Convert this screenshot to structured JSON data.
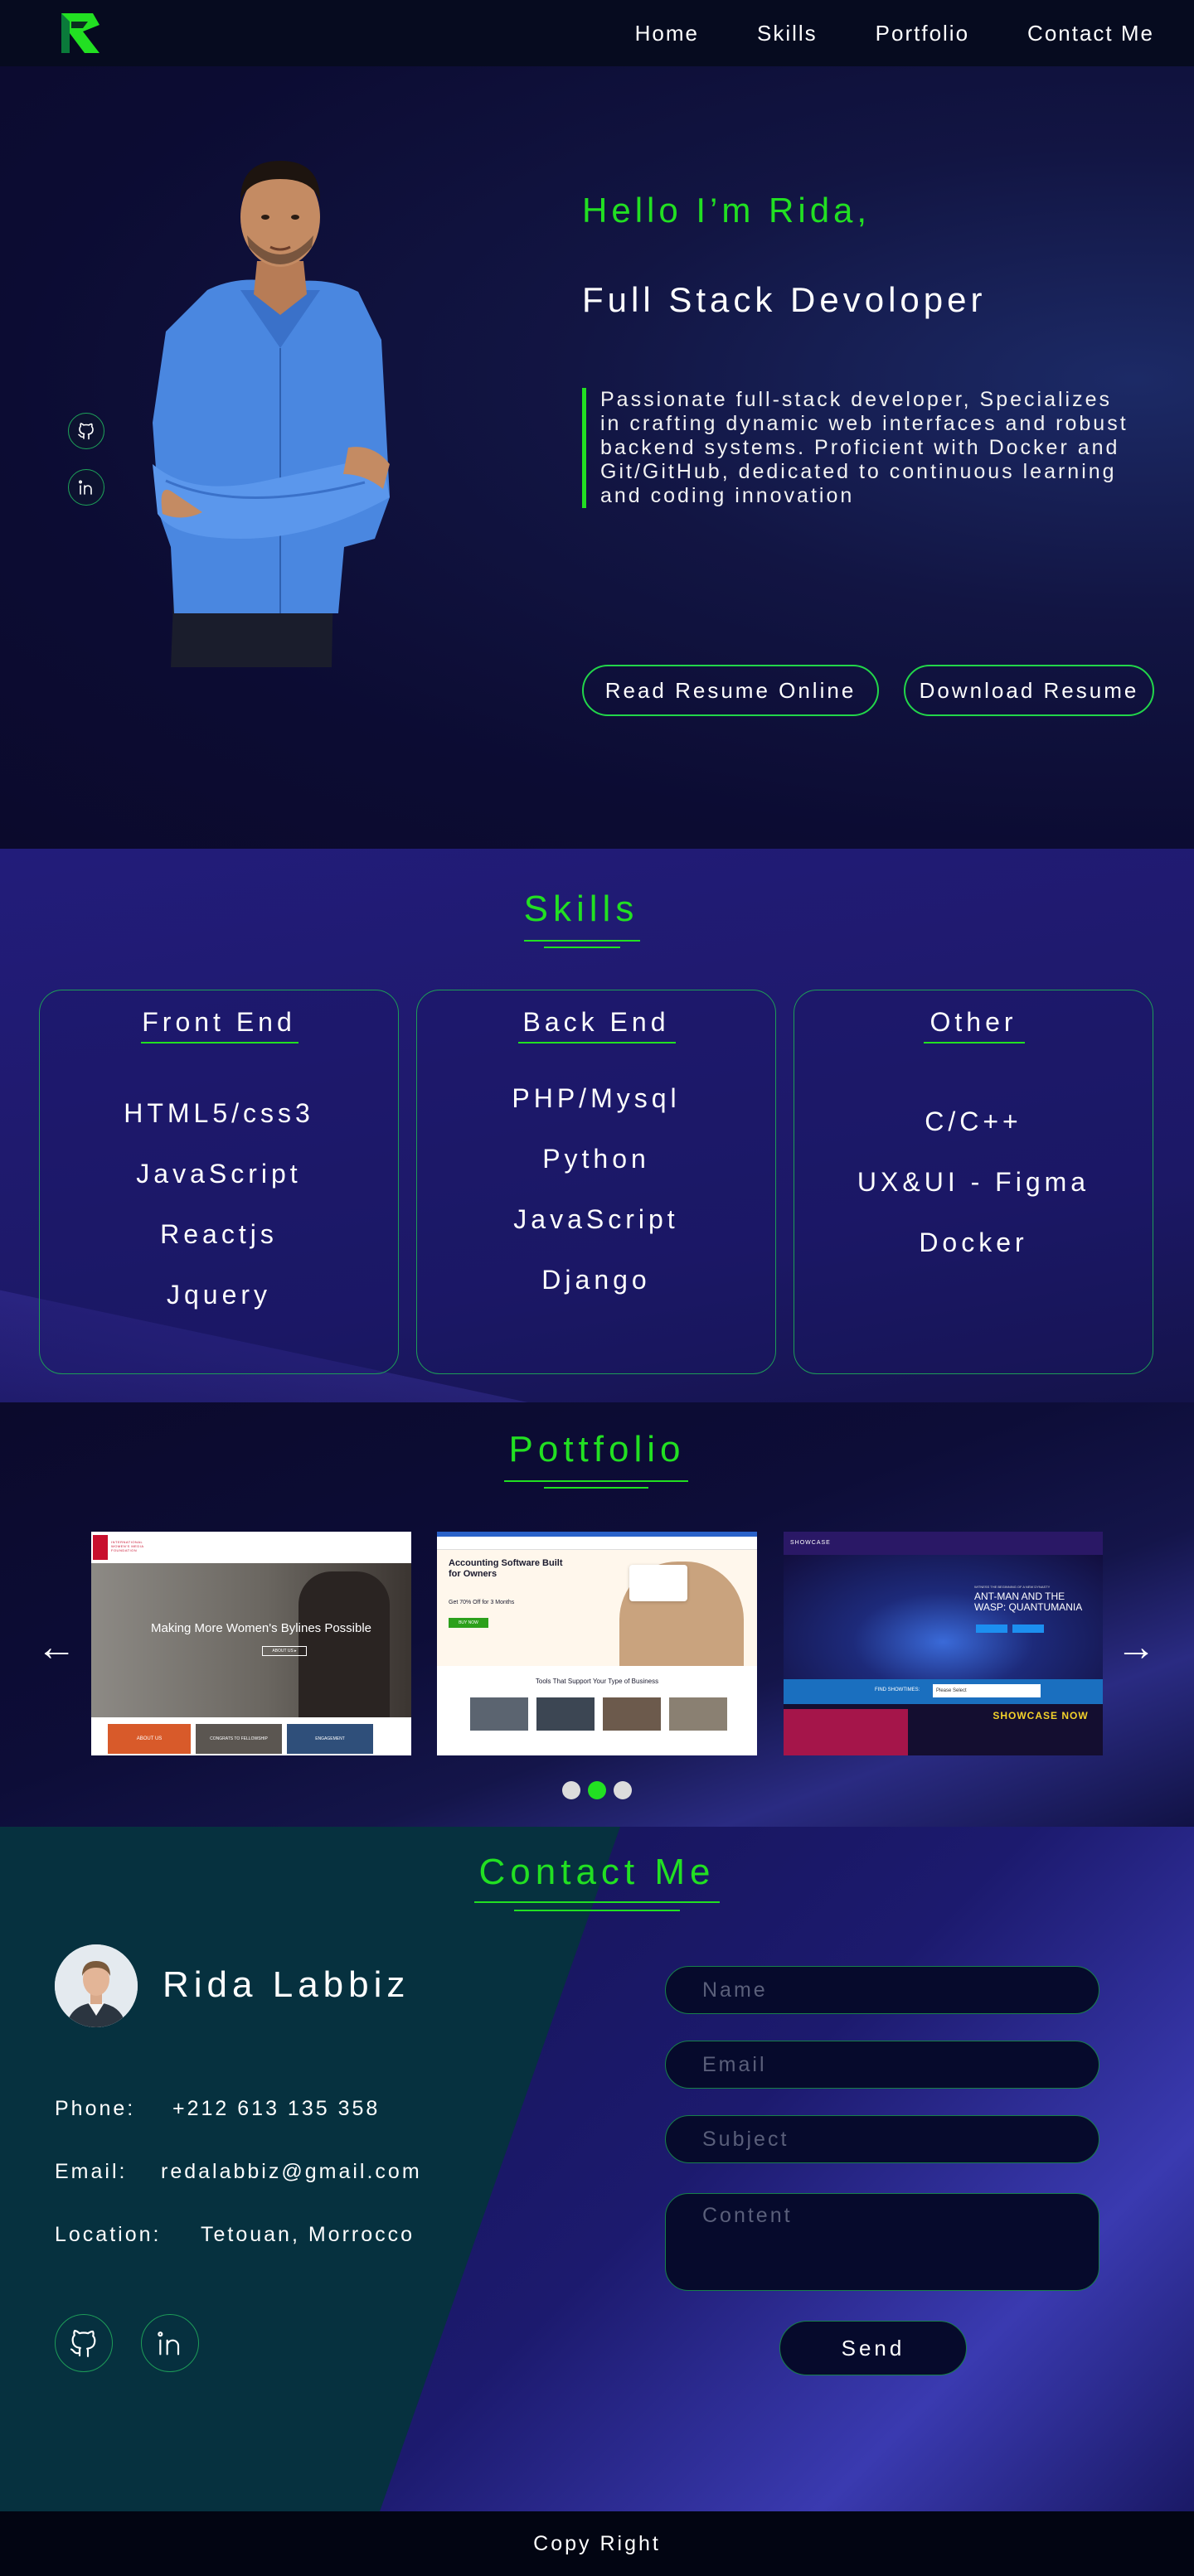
{
  "nav": {
    "logo_icon": "brand-logo",
    "links": [
      "Home",
      "Skills",
      "Portfolio",
      "Contact Me"
    ]
  },
  "hero": {
    "greeting": "Hello I’m Rida,",
    "role": "Full Stack Devoloper",
    "description": "Passionate full-stack developer, Specializes in crafting dynamic web interfaces and robust backend systems. Proficient with Docker and Git/GitHub, dedicated to continuous learning and coding innovation",
    "buttons": [
      "Read Resume Online",
      "Download Resume"
    ],
    "side_icons": [
      "github-icon",
      "linkedin-icon"
    ]
  },
  "skills": {
    "title": "Skills",
    "cards": [
      {
        "title": "Front End",
        "items": [
          "HTML5/css3",
          "JavaScript",
          "Reactjs",
          "Jquery"
        ]
      },
      {
        "title": "Back End",
        "items": [
          "PHP/Mysql",
          "Python",
          "JavaScript",
          "Django"
        ]
      },
      {
        "title": "Other",
        "items": [
          "C/C++",
          "UX&UI - Figma",
          "Docker"
        ]
      }
    ]
  },
  "portfolio": {
    "title": "Pottfolio",
    "prev": "←",
    "next": "→",
    "slides": [
      {
        "headline": "Making More Women's Bylines Possible",
        "tag": "ABOUT US ▸",
        "nav_brand": "INTERNATIONAL WOMEN'S MEDIA FOUNDATION",
        "tiles": [
          "ABOUT US",
          "CONGRATS TO FELLOWSHIP",
          "ENGAGEMENT"
        ]
      },
      {
        "headline": "Accounting Software Built for Owners",
        "sub": "Get 70% Off for 3 Months",
        "cta": "BUY NOW",
        "section": "Tools That Support Your Type of Business"
      },
      {
        "brand": "SHOWCASE",
        "headline": "ANT-MAN AND THE WASP: QUANTUMANIA",
        "sub": "WITNESS THE BEGINNING OF A NEW DYNASTY",
        "find": "FIND SHOWTIMES:",
        "select": "Please Select",
        "banner": "SHOWCASE NOW"
      }
    ],
    "active_dot": 1,
    "dot_count": 3
  },
  "contact": {
    "title": "Contact Me",
    "name": "Rida Labbiz",
    "phone_label": "Phone:",
    "phone": "+212 613 135 358",
    "email_label": "Email:",
    "email": "redalabbiz@gmail.com",
    "location_label": "Location:",
    "location": "Tetouan, Morrocco",
    "socials": [
      "github-icon",
      "linkedin-icon"
    ],
    "form": {
      "name_placeholder": "Name",
      "email_placeholder": "Email",
      "subject_placeholder": "Subject",
      "content_placeholder": "Content",
      "send_label": "Send"
    }
  },
  "footer": {
    "text": "Copy Right"
  },
  "colors": {
    "accent": "#22e022",
    "nav_bg": "#060b1f",
    "contact_teal": "#06313f",
    "footer_bg": "#020512"
  }
}
